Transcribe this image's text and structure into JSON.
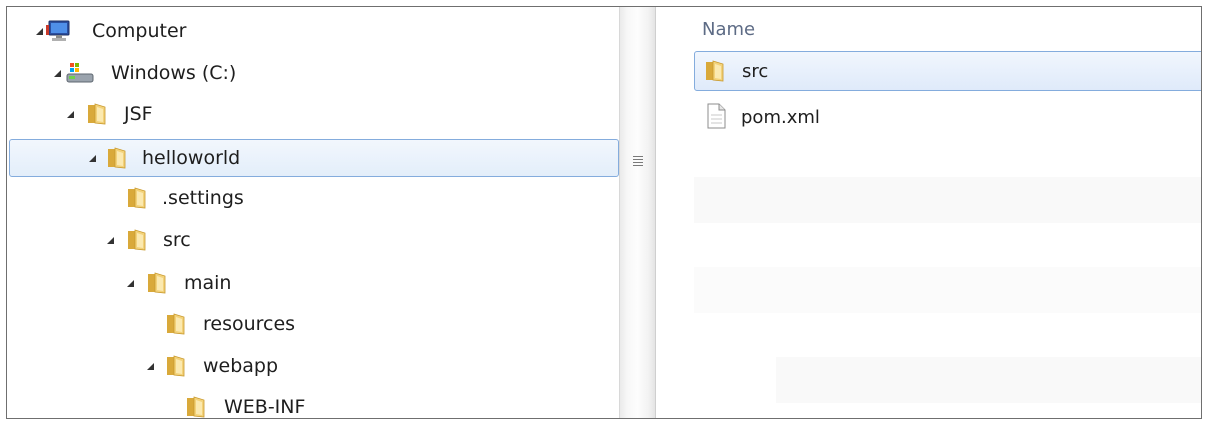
{
  "tree": {
    "items": [
      {
        "label": "Computer",
        "icon": "computer-icon",
        "expanded": true
      },
      {
        "label": "Windows (C:)",
        "icon": "drive-icon",
        "expanded": true
      },
      {
        "label": "JSF",
        "icon": "folder-icon",
        "expanded": true
      },
      {
        "label": "helloworld",
        "icon": "folder-icon",
        "expanded": true,
        "selected": true
      },
      {
        "label": ".settings",
        "icon": "folder-icon",
        "expanded": false
      },
      {
        "label": "src",
        "icon": "folder-icon",
        "expanded": true
      },
      {
        "label": "main",
        "icon": "folder-icon",
        "expanded": true
      },
      {
        "label": "resources",
        "icon": "folder-icon",
        "expanded": false
      },
      {
        "label": "webapp",
        "icon": "folder-icon",
        "expanded": true
      },
      {
        "label": "WEB-INF",
        "icon": "folder-icon",
        "expanded": false
      }
    ]
  },
  "file_list": {
    "column_header": "Name",
    "items": [
      {
        "label": "src",
        "icon": "folder-icon",
        "selected": true
      },
      {
        "label": "pom.xml",
        "icon": "document-icon",
        "selected": false
      }
    ]
  },
  "colors": {
    "selection_border": "#84acdd",
    "selection_fill": "#e3eefa",
    "folder": "#e8c15a",
    "header_text": "#5d6b85"
  }
}
